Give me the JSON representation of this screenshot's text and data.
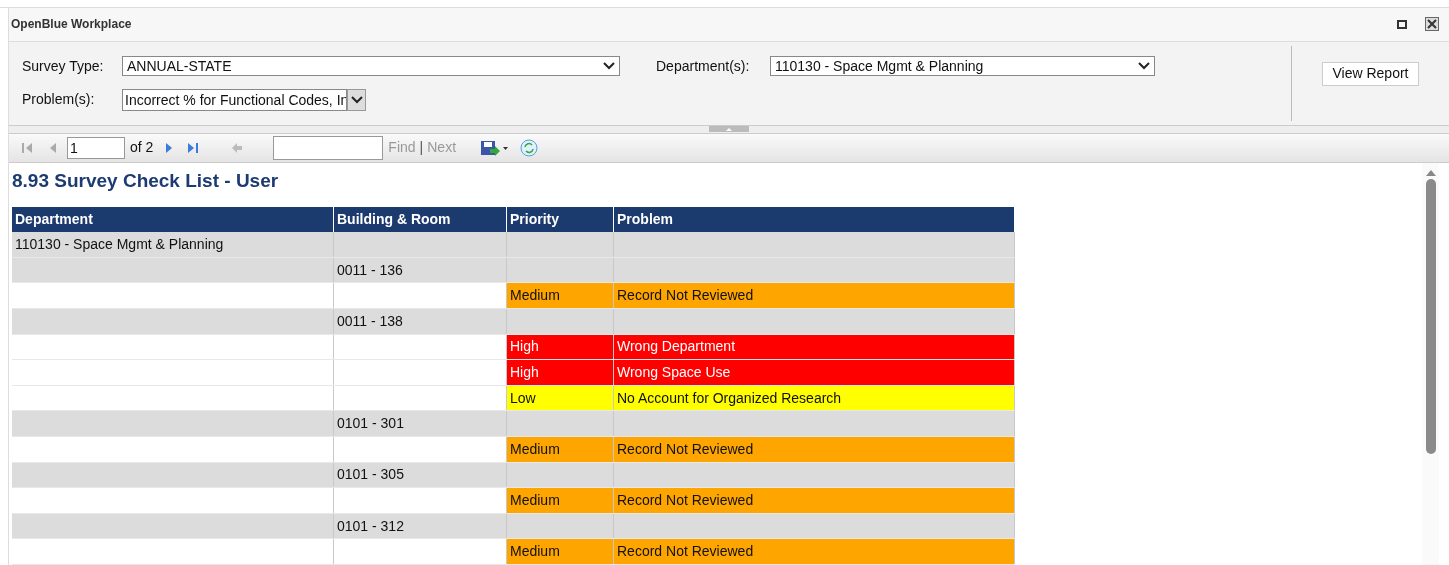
{
  "window": {
    "title": "OpenBlue Workplace"
  },
  "filters": [
    {
      "label": "Survey Type:",
      "value": "ANNUAL-STATE",
      "kind": "select"
    },
    {
      "label": "Department(s):",
      "value": "110130 - Space Mgmt & Planning",
      "kind": "select"
    },
    {
      "label": "Problem(s):",
      "value": "Incorrect % for Functional Codes, In",
      "kind": "multiselect"
    }
  ],
  "view_button": "View Report",
  "toolbar": {
    "page": "1",
    "of": "of 2",
    "find": "Find",
    "separator": "|",
    "next": "Next"
  },
  "report": {
    "title": "8.93 Survey Check List - User",
    "columns": [
      "Department",
      "Building & Room",
      "Priority",
      "Problem"
    ],
    "rows": [
      {
        "kind": "department",
        "text": "110130 - Space Mgmt & Planning"
      },
      {
        "kind": "room",
        "text": "0011 - 136"
      },
      {
        "kind": "problem",
        "priority": "Medium",
        "problem": "Record Not Reviewed",
        "color": "#ffa500"
      },
      {
        "kind": "room",
        "text": "0011 - 138"
      },
      {
        "kind": "problem",
        "priority": "High",
        "problem": "Wrong Department",
        "color": "#ff0000"
      },
      {
        "kind": "problem",
        "priority": "High",
        "problem": "Wrong Space Use",
        "color": "#ff0000"
      },
      {
        "kind": "problem",
        "priority": "Low",
        "problem": "No Account for Organized Research",
        "color": "#ffff00"
      },
      {
        "kind": "room",
        "text": "0101 - 301"
      },
      {
        "kind": "problem",
        "priority": "Medium",
        "problem": "Record Not Reviewed",
        "color": "#ffa500"
      },
      {
        "kind": "room",
        "text": "0101 - 305"
      },
      {
        "kind": "problem",
        "priority": "Medium",
        "problem": "Record Not Reviewed",
        "color": "#ffa500"
      },
      {
        "kind": "room",
        "text": "0101 - 312"
      },
      {
        "kind": "problem",
        "priority": "Medium",
        "problem": "Record Not Reviewed",
        "color": "#ffa500"
      }
    ]
  }
}
